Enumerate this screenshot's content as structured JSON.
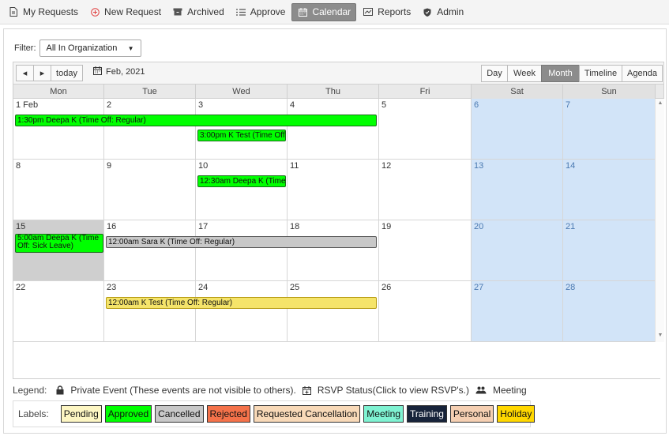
{
  "nav": {
    "items": [
      {
        "label": "My Requests",
        "icon": "document-icon"
      },
      {
        "label": "New Request",
        "icon": "plus-circle-icon"
      },
      {
        "label": "Archived",
        "icon": "archive-icon"
      },
      {
        "label": "Approve",
        "icon": "list-icon"
      },
      {
        "label": "Calendar",
        "icon": "calendar-icon",
        "active": true
      },
      {
        "label": "Reports",
        "icon": "chart-icon"
      },
      {
        "label": "Admin",
        "icon": "shield-icon"
      }
    ]
  },
  "filter": {
    "label": "Filter:",
    "value": "All In Organization"
  },
  "toolbar": {
    "prev": "◂",
    "next": "▸",
    "today": "today",
    "date": "Feb, 2021",
    "views": [
      "Day",
      "Week",
      "Month",
      "Timeline",
      "Agenda"
    ],
    "active_view": "Month"
  },
  "calendar": {
    "dow": [
      "Mon",
      "Tue",
      "Wed",
      "Thu",
      "Fri",
      "Sat",
      "Sun"
    ],
    "weeks": [
      [
        "1 Feb",
        "2",
        "3",
        "4",
        "5",
        "6",
        "7"
      ],
      [
        "8",
        "9",
        "10",
        "11",
        "12",
        "13",
        "14"
      ],
      [
        "15",
        "16",
        "17",
        "18",
        "19",
        "20",
        "21"
      ],
      [
        "22",
        "23",
        "24",
        "25",
        "26",
        "27",
        "28"
      ]
    ],
    "events": [
      {
        "text": "1:30pm Deepa K (Time Off: Regular)",
        "color": "#00ff00"
      },
      {
        "text": "3:00pm K Test (Time Off:",
        "color": "#00ff00"
      },
      {
        "text": "12:30am Deepa K (Time",
        "color": "#00ff00"
      },
      {
        "text": "5:00am Deepa K (Time Off: Sick Leave)",
        "color": "#00ff00"
      },
      {
        "text": "12:00am Sara K (Time Off: Regular)",
        "color": "#c8c8c8"
      },
      {
        "text": "12:00am K Test (Time Off: Regular)",
        "color": "#f5e46a"
      }
    ]
  },
  "legend": {
    "title": "Legend:",
    "private": "Private Event (These events are not visible to others).",
    "rsvp": "RSVP Status(Click to view RSVP's.)",
    "meeting": "Meeting"
  },
  "labels": {
    "title": "Labels:",
    "items": [
      {
        "text": "Pending",
        "bg": "#fdf6c3",
        "fg": "#111"
      },
      {
        "text": "Approved",
        "bg": "#00ff00",
        "fg": "#111"
      },
      {
        "text": "Cancelled",
        "bg": "#c8c8c8",
        "fg": "#111"
      },
      {
        "text": "Rejected",
        "bg": "#f4724a",
        "fg": "#111"
      },
      {
        "text": "Requested Cancellation",
        "bg": "#f8d9b8",
        "fg": "#111"
      },
      {
        "text": "Meeting",
        "bg": "#7ff2d2",
        "fg": "#111"
      },
      {
        "text": "Training",
        "bg": "#17233a",
        "fg": "#ffffff"
      },
      {
        "text": "Personal",
        "bg": "#f5cfb2",
        "fg": "#111"
      },
      {
        "text": "Holiday",
        "bg": "#ffd700",
        "fg": "#111"
      }
    ]
  }
}
